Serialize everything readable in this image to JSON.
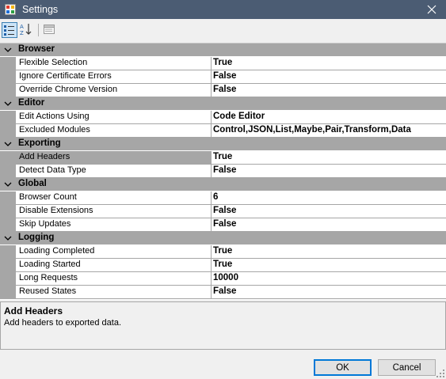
{
  "window": {
    "title": "Settings"
  },
  "toolbar": {
    "categorized_icon": "categorized-view-icon",
    "alphabetical_icon": "alphabetical-sort-icon",
    "property_pages_icon": "property-pages-icon"
  },
  "grid": {
    "categories": [
      {
        "label": "Browser",
        "props": [
          {
            "name": "Flexible Selection",
            "value": "True"
          },
          {
            "name": "Ignore Certificate Errors",
            "value": "False"
          },
          {
            "name": "Override Chrome Version",
            "value": "False"
          }
        ]
      },
      {
        "label": "Editor",
        "props": [
          {
            "name": "Edit Actions Using",
            "value": "Code Editor"
          },
          {
            "name": "Excluded Modules",
            "value": "Control,JSON,List,Maybe,Pair,Transform,Data"
          }
        ]
      },
      {
        "label": "Exporting",
        "props": [
          {
            "name": "Add Headers",
            "value": "True",
            "selected": true
          },
          {
            "name": "Detect Data Type",
            "value": "False"
          }
        ]
      },
      {
        "label": "Global",
        "props": [
          {
            "name": "Browser Count",
            "value": "6"
          },
          {
            "name": "Disable Extensions",
            "value": "False"
          },
          {
            "name": "Skip Updates",
            "value": "False"
          }
        ]
      },
      {
        "label": "Logging",
        "props": [
          {
            "name": "Loading Completed",
            "value": "True"
          },
          {
            "name": "Loading Started",
            "value": "True"
          },
          {
            "name": "Long Requests",
            "value": "10000"
          },
          {
            "name": "Reused States",
            "value": "False"
          }
        ]
      }
    ]
  },
  "help": {
    "title": "Add Headers",
    "description": "Add headers to exported data."
  },
  "buttons": {
    "ok": "OK",
    "cancel": "Cancel"
  },
  "colors": {
    "titlebar": "#4b5c73",
    "category_band": "#a6a6a6",
    "selection": "#cce4f7"
  }
}
